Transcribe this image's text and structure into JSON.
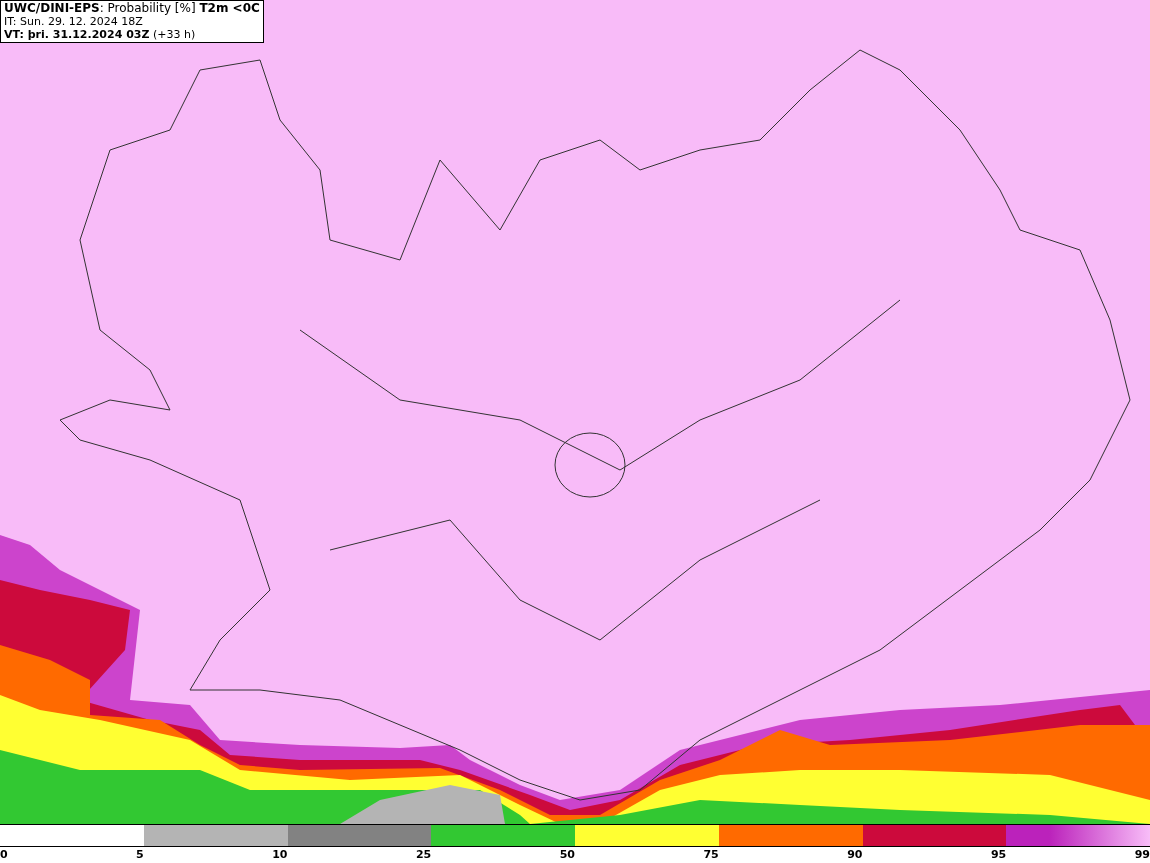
{
  "header": {
    "title": "**UWC/DINI-EPS**: Probability [%] **T2m <0C**",
    "init_time": "IT: Sun. 29. 12. 2024 18Z",
    "valid_time": "**VT: þri. 31.12.2024 03Z** (+33 h)"
  },
  "legend": {
    "segments": [
      {
        "color": "#ffffff"
      },
      {
        "color": "#b4b4b4"
      },
      {
        "color": "#828282"
      },
      {
        "color": "#32c832"
      },
      {
        "color": "#ffff32"
      },
      {
        "color": "#ff6a00"
      },
      {
        "color": "#cc0a3c"
      },
      {
        "color": "#bb22bb"
      }
    ],
    "labels": [
      "0",
      "5",
      "10",
      "25",
      "50",
      "75",
      "90",
      "95",
      "99"
    ]
  }
}
